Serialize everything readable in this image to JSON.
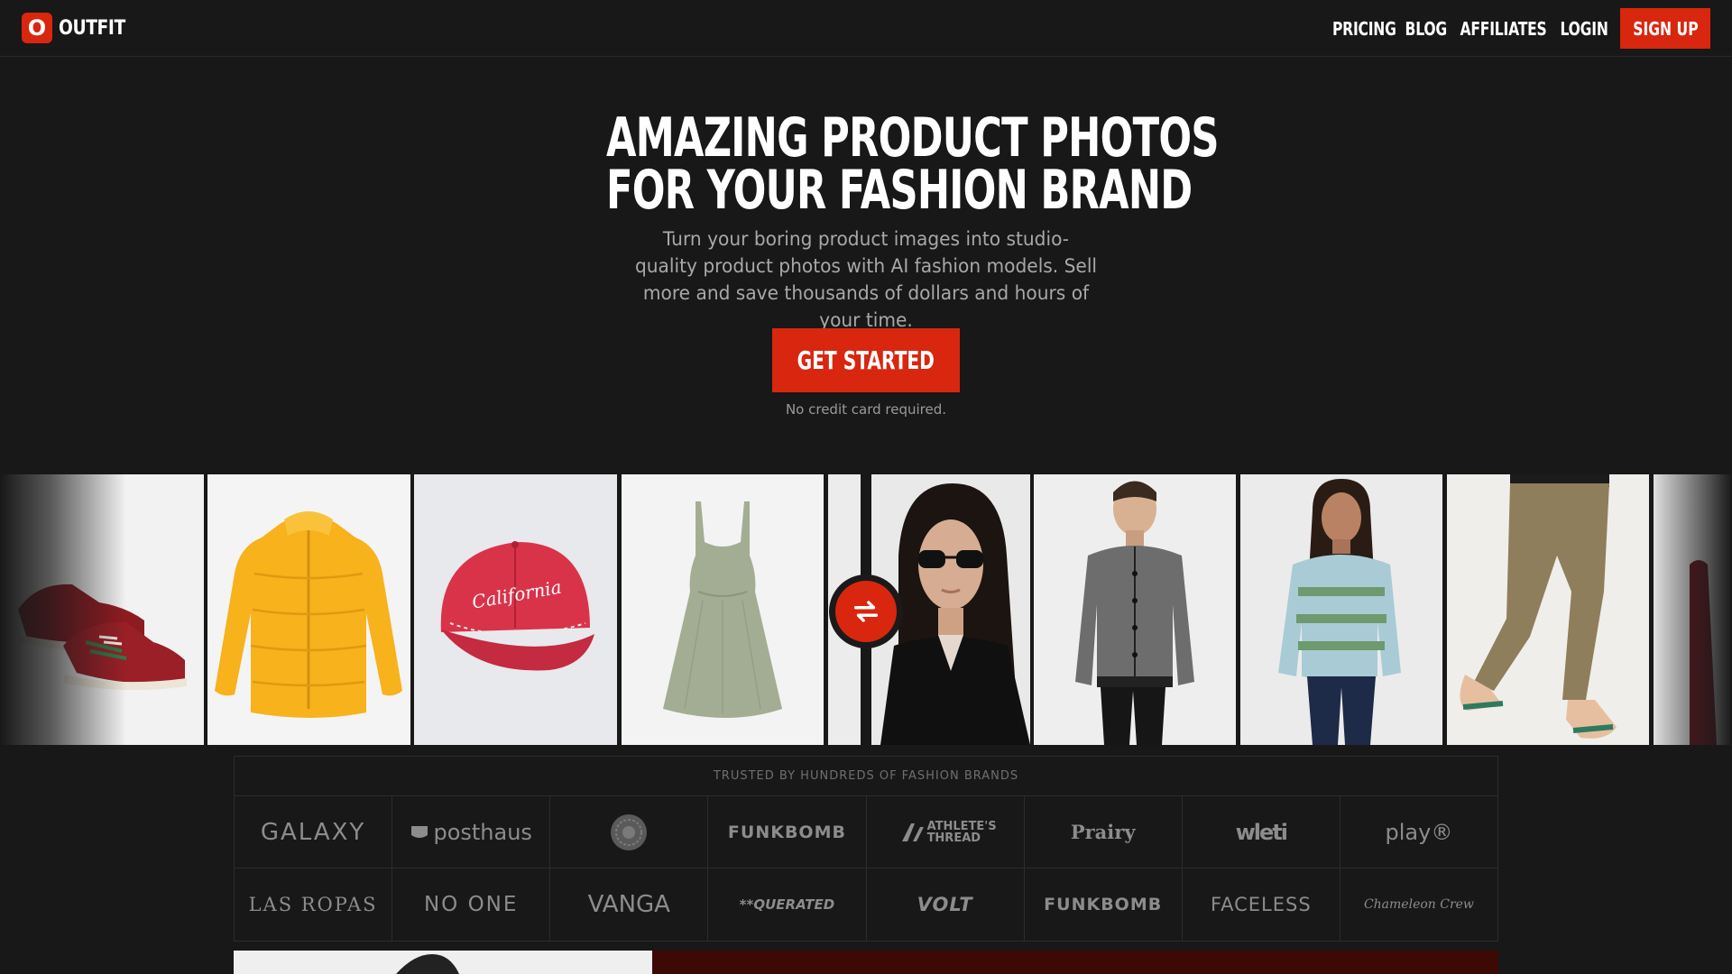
{
  "nav": {
    "brand_mark": "O",
    "brand_name": "OUTFIT",
    "links": [
      "PRICING",
      "BLOG",
      "AFFILIATES",
      "LOGIN"
    ],
    "cta": "SIGN UP"
  },
  "hero": {
    "title_line1": "AMAZING PRODUCT PHOTOS",
    "title_line2": "FOR YOUR FASHION BRAND",
    "subtitle": "Turn your boring product images into studio-quality product photos with AI fashion models. Sell more and save thousands of dollars and hours of your time.",
    "cta": "GET STARTED",
    "note": "No credit card required."
  },
  "gallery": {
    "before_items": [
      "red-sneakers",
      "yellow-puffer-jacket",
      "red-california-cap",
      "sage-sundress"
    ],
    "cap_text": "California",
    "after_items": [
      "model-sunglasses-blazer",
      "model-grey-cardigan",
      "model-green-sweater",
      "model-khaki-pants-sneakers"
    ]
  },
  "trust": {
    "heading": "TRUSTED BY HUNDREDS OF FASHION BRANDS",
    "row1": [
      "GALAXY",
      "posthaus",
      "",
      "FUNKBOMB",
      "ATHLETE'S THREAD",
      "Prairy",
      "wleti",
      "play®"
    ],
    "row2": [
      "LAS ROPAS",
      "NO ONE",
      "VANGA",
      "**QUERATED",
      "VOLT",
      "FUNKBOMB",
      "FACELESS",
      "Chameleon Crew"
    ]
  },
  "colors": {
    "accent": "#d9260f",
    "background": "#181818"
  }
}
